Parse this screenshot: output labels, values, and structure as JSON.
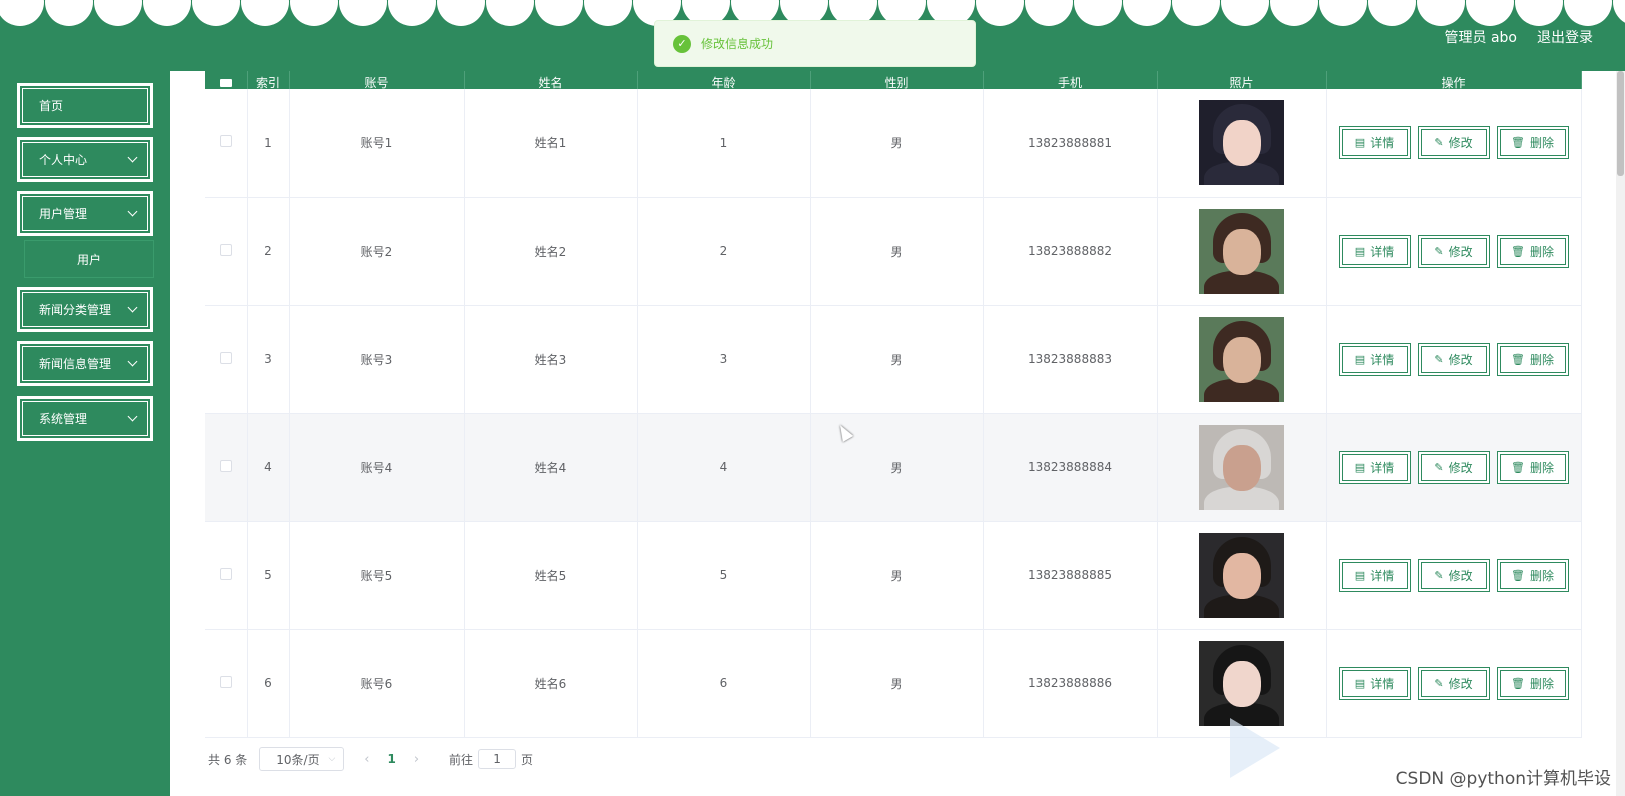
{
  "header": {
    "user_label": "管理员 abo",
    "logout_label": "退出登录"
  },
  "toast": {
    "message": "修改信息成功",
    "icon": "check-icon"
  },
  "sidebar": {
    "items": [
      {
        "label": "首页",
        "has_children": false
      },
      {
        "label": "个人中心",
        "has_children": true
      },
      {
        "label": "用户管理",
        "has_children": true
      },
      {
        "label": "新闻分类管理",
        "has_children": true
      },
      {
        "label": "新闻信息管理",
        "has_children": true
      },
      {
        "label": "系统管理",
        "has_children": true
      }
    ],
    "subitem": "用户"
  },
  "table": {
    "columns": [
      "",
      "索引",
      "账号",
      "姓名",
      "年龄",
      "性别",
      "手机",
      "照片",
      "操作"
    ],
    "rows": [
      {
        "index": "1",
        "account": "账号1",
        "name": "姓名1",
        "age": "1",
        "gender": "男",
        "phone": "13823888881",
        "photo_colors": [
          "#2a2a3a",
          "#f1d3c8",
          "#1f1f2c"
        ]
      },
      {
        "index": "2",
        "account": "账号2",
        "name": "姓名2",
        "age": "2",
        "gender": "男",
        "phone": "13823888882",
        "photo_colors": [
          "#3e2a22",
          "#d9b39a",
          "#5a7a5a"
        ]
      },
      {
        "index": "3",
        "account": "账号3",
        "name": "姓名3",
        "age": "3",
        "gender": "男",
        "phone": "13823888883",
        "photo_colors": [
          "#3e2a22",
          "#d9b39a",
          "#5a7a5a"
        ]
      },
      {
        "index": "4",
        "account": "账号4",
        "name": "姓名4",
        "age": "4",
        "gender": "男",
        "phone": "13823888884",
        "photo_colors": [
          "#d8d6d4",
          "#c9a08e",
          "#bdb9b5"
        ]
      },
      {
        "index": "5",
        "account": "账号5",
        "name": "姓名5",
        "age": "5",
        "gender": "男",
        "phone": "13823888885",
        "photo_colors": [
          "#1e1a18",
          "#e2b7a2",
          "#2b2a2d"
        ]
      },
      {
        "index": "6",
        "account": "账号6",
        "name": "姓名6",
        "age": "6",
        "gender": "男",
        "phone": "13823888886",
        "photo_colors": [
          "#161616",
          "#f0d6cc",
          "#2a2a2a"
        ]
      }
    ],
    "actions": {
      "detail": "详情",
      "edit": "修改",
      "delete": "删除"
    }
  },
  "pagination": {
    "total": "共 6 条",
    "page_size": "10条/页",
    "current_page": "1",
    "goto_label": "前往",
    "goto_value": "1",
    "page_suffix": "页"
  },
  "watermark": "CSDN @python计算机毕设",
  "colors": {
    "primary": "#2e8a5e",
    "success": "#67c23a"
  }
}
